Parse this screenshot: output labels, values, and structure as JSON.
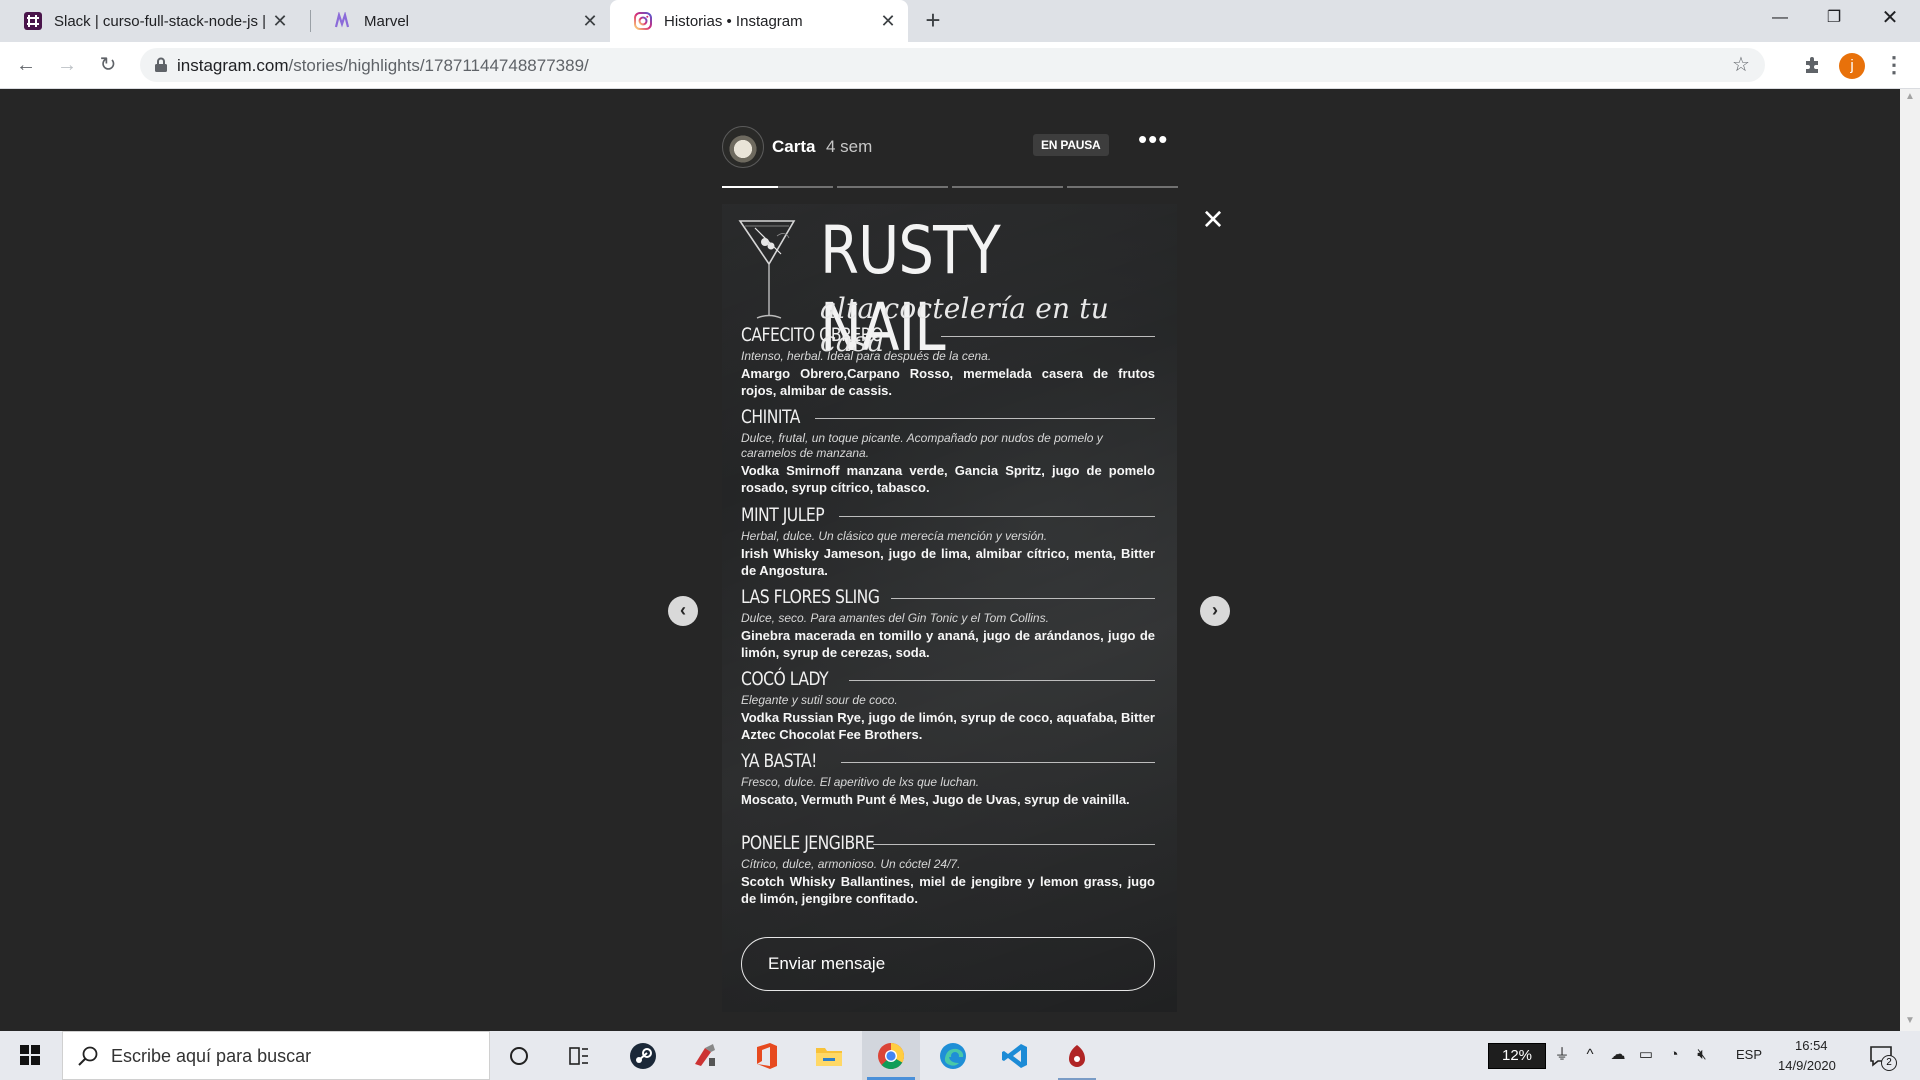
{
  "browser": {
    "tabs": [
      {
        "title": "Slack | curso-full-stack-node-js |",
        "icon": "slack-icon"
      },
      {
        "title": "Marvel",
        "icon": "marvel-icon"
      },
      {
        "title": "Historias • Instagram",
        "icon": "instagram-icon",
        "active": true
      }
    ],
    "url_host": "instagram.com",
    "url_path": "/stories/highlights/17871144748877389/",
    "profile_initial": "j"
  },
  "story": {
    "username": "Carta",
    "time_ago": "4 sem",
    "status_badge": "EN PAUSA",
    "progress_segments": 4,
    "brand_title": "RUSTY NAIL",
    "tagline": "alta coctelería en tu casa",
    "menu": [
      {
        "name": "Cafecito Obrero",
        "description": "Intenso, herbal. Ideal para después de la cena.",
        "ingredients": "Amargo Obrero,Carpano Rosso, mermelada casera de frutos rojos, almibar de cassis."
      },
      {
        "name": "Chinita",
        "description": "Dulce, frutal, un toque picante. Acompañado por nudos de pomelo y caramelos de manzana.",
        "ingredients": "Vodka Smirnoff  manzana verde, Gancia Spritz, jugo de pomelo rosado, syrup cítrico, tabasco."
      },
      {
        "name": "Mint Julep",
        "description": "Herbal, dulce. Un clásico que merecía mención y versión.",
        "ingredients": "Irish Whisky Jameson, jugo de lima, almibar cítrico, menta, Bitter de Angostura."
      },
      {
        "name": "Las Flores Sling",
        "description": "Dulce, seco. Para amantes del Gin Tonic y el Tom Collins.",
        "ingredients": "Ginebra macerada en tomillo y ananá, jugo de arándanos, jugo de limón, syrup de cerezas, soda."
      },
      {
        "name": "Cocó Lady",
        "description": "Elegante y sutil sour de coco.",
        "ingredients": "Vodka Russian Rye, jugo de limón, syrup de coco, aquafaba, Bitter Aztec Chocolat Fee Brothers."
      },
      {
        "name": "Ya Basta!",
        "description": "Fresco, dulce. El aperitivo de lxs que luchan.",
        "ingredients": "Moscato, Vermuth Punt é Mes, Jugo de Uvas, syrup de vainilla."
      },
      {
        "name": "Ponele Jengibre",
        "description": "Cítrico, dulce, armonioso. Un cóctel 24/7.",
        "ingredients": "Scotch Whisky Ballantines, miel de jengibre y lemon grass, jugo de limón, jengibre confitado."
      }
    ],
    "message_placeholder": "Enviar mensaje"
  },
  "taskbar": {
    "search_placeholder": "Escribe aquí para buscar",
    "battery": "12%",
    "language": "ESP",
    "time": "16:54",
    "date": "14/9/2020",
    "notification_count": "2"
  }
}
